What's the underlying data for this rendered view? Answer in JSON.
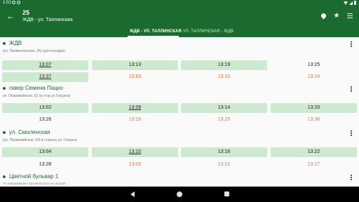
{
  "status_bar": {
    "time": "1:02"
  },
  "header": {
    "route_number": "25",
    "route_subtitle": "ЖДВ - ул. Таллинская"
  },
  "tabs": [
    {
      "label": "ЖДВ - УЛ. ТАЛЛИНСКАЯ",
      "selected": true
    },
    {
      "label": "УЛ. ТАЛЛИНСКАЯ - ЖДВ",
      "selected": false
    }
  ],
  "stops": [
    {
      "name": "ЖДВ",
      "address": "(ул. Привокзальная, 25) (для посадки)",
      "rows": [
        [
          {
            "time": "13:07",
            "scheduled": true,
            "underline": true
          },
          {
            "time": "13:13",
            "scheduled": true
          },
          {
            "time": "13:19",
            "scheduled": true
          },
          {
            "time": "13:25",
            "scheduled": false
          }
        ],
        [
          {
            "time": "13:37",
            "scheduled": true,
            "underline": true
          },
          {
            "time": "13:63",
            "late": true
          },
          {
            "time": "13:10",
            "late": true
          },
          {
            "time": "13:24",
            "late": true
          }
        ]
      ]
    },
    {
      "name": "сквер Семена Пацко",
      "address": "ул. Первомайская, 53 (в стор.ул.Герцена)",
      "rows": [
        [
          {
            "time": "13:02",
            "scheduled": true
          },
          {
            "time": "13:08",
            "scheduled": true,
            "underline": true
          },
          {
            "time": "13:14",
            "scheduled": true
          },
          {
            "time": "13:20",
            "scheduled": true
          }
        ],
        [
          {
            "time": "13:26",
            "scheduled": false
          },
          {
            "time": "13:19",
            "late": true
          },
          {
            "time": "13:25",
            "late": true
          },
          {
            "time": "13:36",
            "late": true
          }
        ]
      ]
    },
    {
      "name": "ул. Смоленская",
      "address": "(ул. Первомайская, 23) в сторону ул. Герцена",
      "rows": [
        [
          {
            "time": "13:04",
            "scheduled": true
          },
          {
            "time": "13:10",
            "scheduled": true,
            "underline": true
          },
          {
            "time": "13:16",
            "scheduled": true
          },
          {
            "time": "13:22",
            "scheduled": true
          }
        ],
        [
          {
            "time": "13:28",
            "scheduled": false
          },
          {
            "time": "13:03",
            "late": true
          },
          {
            "time": "13:21",
            "late": true
          },
          {
            "time": "13:27",
            "late": true
          }
        ]
      ]
    },
    {
      "name": "Цветной бульвар 1",
      "address": "",
      "rows": []
    }
  ],
  "footer": {
    "text": "По информации Гортранспорта на сегодня"
  },
  "colors": {
    "primary": "#1b6b31",
    "scheduled_bg": "#cde9cf",
    "late": "#e2743f",
    "stop_name": "#2a6a35"
  }
}
